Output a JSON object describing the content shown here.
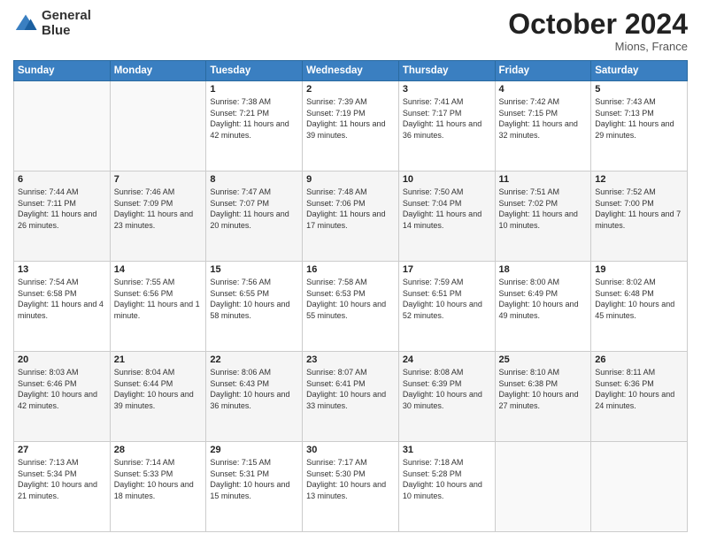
{
  "header": {
    "logo_line1": "General",
    "logo_line2": "Blue",
    "month": "October 2024",
    "location": "Mions, France"
  },
  "weekdays": [
    "Sunday",
    "Monday",
    "Tuesday",
    "Wednesday",
    "Thursday",
    "Friday",
    "Saturday"
  ],
  "weeks": [
    [
      {
        "day": "",
        "info": ""
      },
      {
        "day": "",
        "info": ""
      },
      {
        "day": "1",
        "info": "Sunrise: 7:38 AM\nSunset: 7:21 PM\nDaylight: 11 hours and 42 minutes."
      },
      {
        "day": "2",
        "info": "Sunrise: 7:39 AM\nSunset: 7:19 PM\nDaylight: 11 hours and 39 minutes."
      },
      {
        "day": "3",
        "info": "Sunrise: 7:41 AM\nSunset: 7:17 PM\nDaylight: 11 hours and 36 minutes."
      },
      {
        "day": "4",
        "info": "Sunrise: 7:42 AM\nSunset: 7:15 PM\nDaylight: 11 hours and 32 minutes."
      },
      {
        "day": "5",
        "info": "Sunrise: 7:43 AM\nSunset: 7:13 PM\nDaylight: 11 hours and 29 minutes."
      }
    ],
    [
      {
        "day": "6",
        "info": "Sunrise: 7:44 AM\nSunset: 7:11 PM\nDaylight: 11 hours and 26 minutes."
      },
      {
        "day": "7",
        "info": "Sunrise: 7:46 AM\nSunset: 7:09 PM\nDaylight: 11 hours and 23 minutes."
      },
      {
        "day": "8",
        "info": "Sunrise: 7:47 AM\nSunset: 7:07 PM\nDaylight: 11 hours and 20 minutes."
      },
      {
        "day": "9",
        "info": "Sunrise: 7:48 AM\nSunset: 7:06 PM\nDaylight: 11 hours and 17 minutes."
      },
      {
        "day": "10",
        "info": "Sunrise: 7:50 AM\nSunset: 7:04 PM\nDaylight: 11 hours and 14 minutes."
      },
      {
        "day": "11",
        "info": "Sunrise: 7:51 AM\nSunset: 7:02 PM\nDaylight: 11 hours and 10 minutes."
      },
      {
        "day": "12",
        "info": "Sunrise: 7:52 AM\nSunset: 7:00 PM\nDaylight: 11 hours and 7 minutes."
      }
    ],
    [
      {
        "day": "13",
        "info": "Sunrise: 7:54 AM\nSunset: 6:58 PM\nDaylight: 11 hours and 4 minutes."
      },
      {
        "day": "14",
        "info": "Sunrise: 7:55 AM\nSunset: 6:56 PM\nDaylight: 11 hours and 1 minute."
      },
      {
        "day": "15",
        "info": "Sunrise: 7:56 AM\nSunset: 6:55 PM\nDaylight: 10 hours and 58 minutes."
      },
      {
        "day": "16",
        "info": "Sunrise: 7:58 AM\nSunset: 6:53 PM\nDaylight: 10 hours and 55 minutes."
      },
      {
        "day": "17",
        "info": "Sunrise: 7:59 AM\nSunset: 6:51 PM\nDaylight: 10 hours and 52 minutes."
      },
      {
        "day": "18",
        "info": "Sunrise: 8:00 AM\nSunset: 6:49 PM\nDaylight: 10 hours and 49 minutes."
      },
      {
        "day": "19",
        "info": "Sunrise: 8:02 AM\nSunset: 6:48 PM\nDaylight: 10 hours and 45 minutes."
      }
    ],
    [
      {
        "day": "20",
        "info": "Sunrise: 8:03 AM\nSunset: 6:46 PM\nDaylight: 10 hours and 42 minutes."
      },
      {
        "day": "21",
        "info": "Sunrise: 8:04 AM\nSunset: 6:44 PM\nDaylight: 10 hours and 39 minutes."
      },
      {
        "day": "22",
        "info": "Sunrise: 8:06 AM\nSunset: 6:43 PM\nDaylight: 10 hours and 36 minutes."
      },
      {
        "day": "23",
        "info": "Sunrise: 8:07 AM\nSunset: 6:41 PM\nDaylight: 10 hours and 33 minutes."
      },
      {
        "day": "24",
        "info": "Sunrise: 8:08 AM\nSunset: 6:39 PM\nDaylight: 10 hours and 30 minutes."
      },
      {
        "day": "25",
        "info": "Sunrise: 8:10 AM\nSunset: 6:38 PM\nDaylight: 10 hours and 27 minutes."
      },
      {
        "day": "26",
        "info": "Sunrise: 8:11 AM\nSunset: 6:36 PM\nDaylight: 10 hours and 24 minutes."
      }
    ],
    [
      {
        "day": "27",
        "info": "Sunrise: 7:13 AM\nSunset: 5:34 PM\nDaylight: 10 hours and 21 minutes."
      },
      {
        "day": "28",
        "info": "Sunrise: 7:14 AM\nSunset: 5:33 PM\nDaylight: 10 hours and 18 minutes."
      },
      {
        "day": "29",
        "info": "Sunrise: 7:15 AM\nSunset: 5:31 PM\nDaylight: 10 hours and 15 minutes."
      },
      {
        "day": "30",
        "info": "Sunrise: 7:17 AM\nSunset: 5:30 PM\nDaylight: 10 hours and 13 minutes."
      },
      {
        "day": "31",
        "info": "Sunrise: 7:18 AM\nSunset: 5:28 PM\nDaylight: 10 hours and 10 minutes."
      },
      {
        "day": "",
        "info": ""
      },
      {
        "day": "",
        "info": ""
      }
    ]
  ]
}
